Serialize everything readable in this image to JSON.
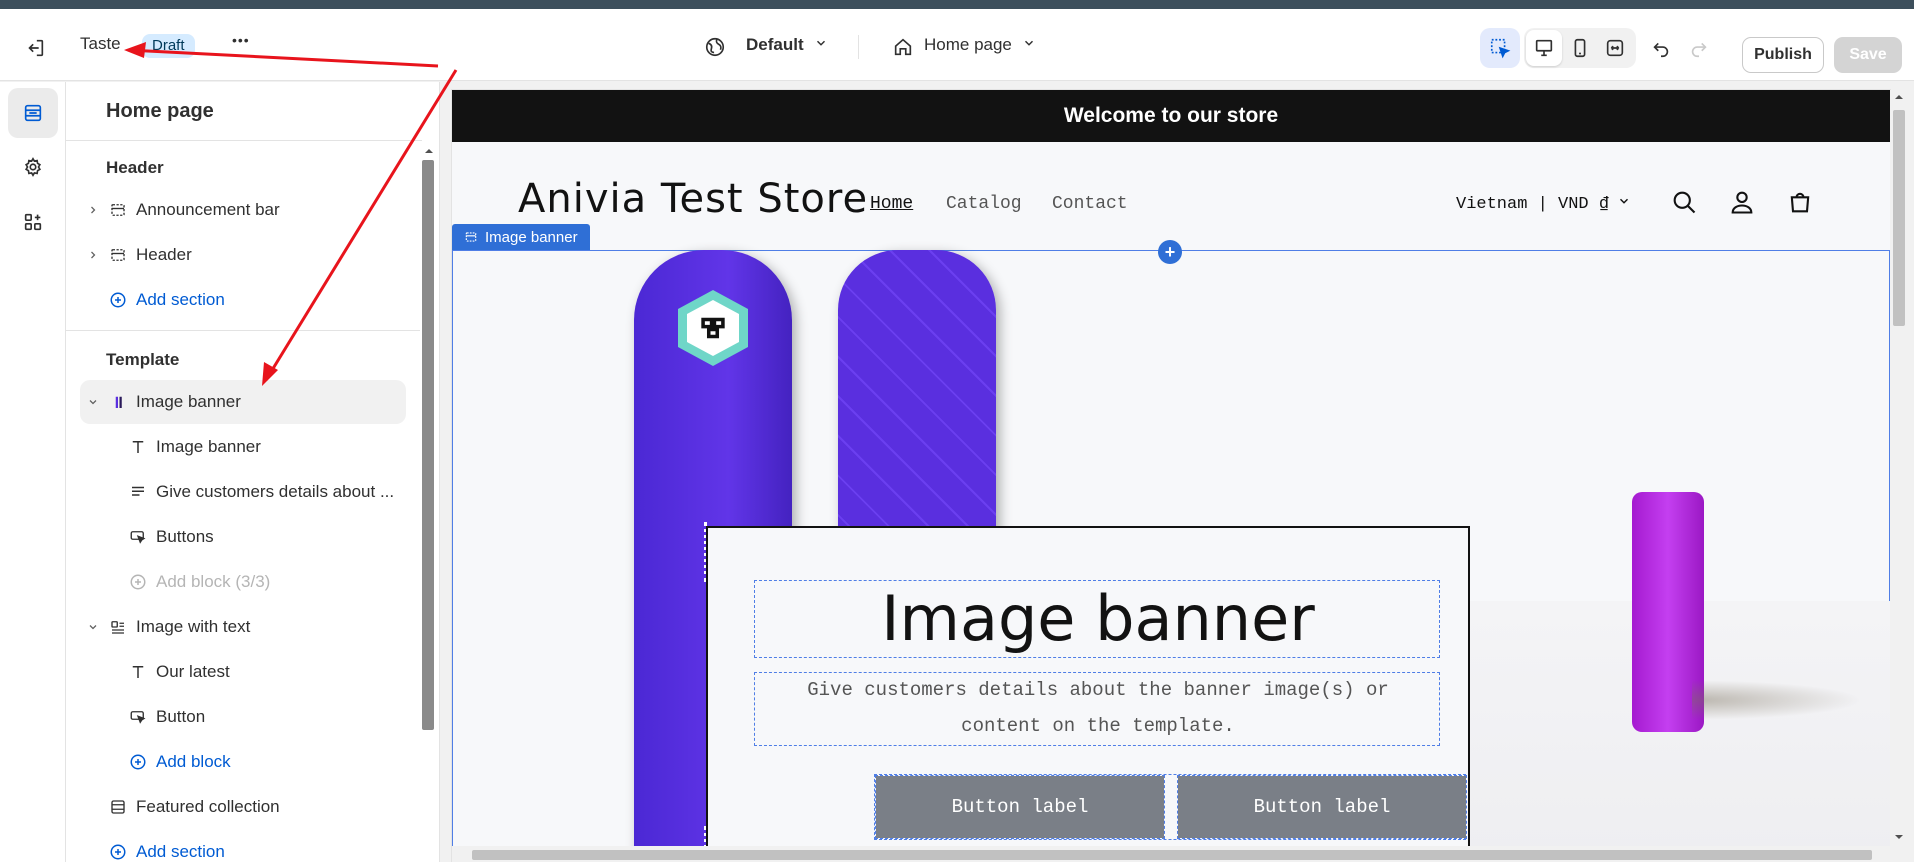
{
  "topbar": {
    "theme_name": "Taste",
    "status_badge": "Draft",
    "more_label": "•••",
    "view_select": "Default",
    "page_select": "Home page",
    "publish_label": "Publish",
    "save_label": "Save"
  },
  "sidebar": {
    "title": "Home page",
    "header_group": "Header",
    "header_items": [
      {
        "label": "Announcement bar"
      },
      {
        "label": "Header"
      }
    ],
    "add_section_1": "Add section",
    "template_group": "Template",
    "template_items": [
      {
        "label": "Image banner"
      },
      {
        "label": "Image banner"
      },
      {
        "label": "Give customers details about ..."
      },
      {
        "label": "Buttons"
      },
      {
        "label": "Add block (3/3)"
      },
      {
        "label": "Image with text"
      },
      {
        "label": "Our latest"
      },
      {
        "label": "Button"
      },
      {
        "label": "Add block"
      },
      {
        "label": "Featured collection"
      }
    ],
    "add_section_2": "Add section"
  },
  "preview": {
    "announcement": "Welcome to our store",
    "store_name": "Anivia Test Store",
    "nav": [
      "Home",
      "Catalog",
      "Contact"
    ],
    "locale": "Vietnam | VND ₫",
    "section_tag": "Image banner",
    "banner_heading": "Image banner",
    "banner_text": "Give customers details about the banner image(s) or content on the template.",
    "button_1": "Button label",
    "button_2": "Button label"
  },
  "colors": {
    "accent_blue": "#005bd3",
    "selection_blue": "#2f6fd6",
    "annotation_red": "#e8141c"
  }
}
